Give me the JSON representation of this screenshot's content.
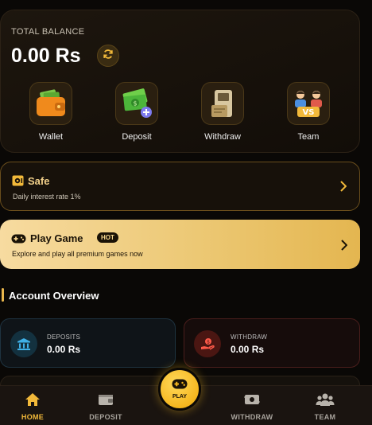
{
  "balance": {
    "label": "TOTAL BALANCE",
    "amount": "0.00 Rs",
    "refresh_icon": "refresh-icon"
  },
  "actions": [
    {
      "label": "Wallet",
      "icon": "wallet-icon"
    },
    {
      "label": "Deposit",
      "icon": "money-plus-icon"
    },
    {
      "label": "Withdraw",
      "icon": "pos-terminal-icon"
    },
    {
      "label": "Team",
      "icon": "team-vs-icon"
    }
  ],
  "safe": {
    "title": "Safe",
    "subtitle": "Daily interest rate 1%",
    "icon": "safe-icon"
  },
  "play_game": {
    "title": "Play Game",
    "badge": "HOT",
    "subtitle": "Explore and play all premium games now",
    "icon": "gamepad-icon"
  },
  "overview": {
    "title": "Account Overview",
    "deposits": {
      "label": "DEPOSITS",
      "value": "0.00 Rs",
      "icon": "bank-icon"
    },
    "withdraw": {
      "label": "WITHDRAW",
      "value": "0.00 Rs",
      "icon": "hand-money-icon"
    }
  },
  "nav": {
    "home": "HOME",
    "deposit": "DEPOSIT",
    "play": "PLAY",
    "withdraw": "WITHDRAW",
    "team": "TEAM"
  },
  "colors": {
    "accent": "#f2b93a",
    "background": "#0a0806",
    "card": "#17110a",
    "gold_gradient_start": "#f7dba0",
    "gold_gradient_end": "#e4b650"
  }
}
